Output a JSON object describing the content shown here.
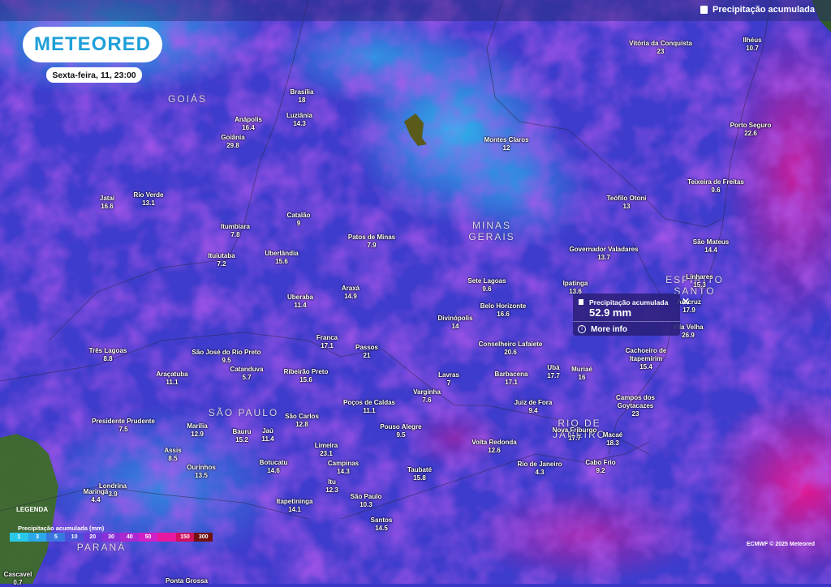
{
  "header": {
    "layer_title": "Precipitação acumulada",
    "layer_icon": "document-icon"
  },
  "brand": {
    "logo_text": "METEORED",
    "date": "Sexta-feira, 11, 23:00"
  },
  "regions": [
    {
      "name": "GOIÁS"
    },
    {
      "name": "MINAS\nGERAIS"
    },
    {
      "name": "SÃO PAULO"
    },
    {
      "name": "RIO DE\nJANEIRO"
    },
    {
      "name": "ESPÍRITO\nSANTO"
    },
    {
      "name": "PARANÁ"
    }
  ],
  "cities": [
    {
      "name": "Vitória da Conquista",
      "value": "23"
    },
    {
      "name": "Ilhéus",
      "value": "10.7"
    },
    {
      "name": "Brasília",
      "value": "18"
    },
    {
      "name": "Luziânia",
      "value": "14.3"
    },
    {
      "name": "Anápolis",
      "value": "16.4"
    },
    {
      "name": "Goiânia",
      "value": "29.8"
    },
    {
      "name": "Montes Claros",
      "value": "12"
    },
    {
      "name": "Porto Seguro",
      "value": "22.6"
    },
    {
      "name": "Teixeira de Freitas",
      "value": "9.6"
    },
    {
      "name": "Jataí",
      "value": "16.6"
    },
    {
      "name": "Rio Verde",
      "value": "13.1"
    },
    {
      "name": "Teófilo Otoni",
      "value": "13"
    },
    {
      "name": "Catalão",
      "value": "9"
    },
    {
      "name": "Itumbiara",
      "value": "7.8"
    },
    {
      "name": "Patos de Minas",
      "value": "7.9"
    },
    {
      "name": "Ituiutaba",
      "value": "7.2"
    },
    {
      "name": "Uberlândia",
      "value": "15.6"
    },
    {
      "name": "São Mateus",
      "value": "14.4"
    },
    {
      "name": "Governador Valadares",
      "value": "13.7"
    },
    {
      "name": "Linhares",
      "value": "15.3"
    },
    {
      "name": "Sete Lagoas",
      "value": "9.6"
    },
    {
      "name": "Ipatinga",
      "value": "13.6"
    },
    {
      "name": "Araxá",
      "value": "14.9"
    },
    {
      "name": "Uberaba",
      "value": "11.4"
    },
    {
      "name": "Belo Horizonte",
      "value": "16.6"
    },
    {
      "name": "Aracruz",
      "value": "17.9"
    },
    {
      "name": "Divinópolis",
      "value": "14"
    },
    {
      "name": "Vila Velha",
      "value": "26.9"
    },
    {
      "name": "Franca",
      "value": "17.1"
    },
    {
      "name": "Passos",
      "value": "21"
    },
    {
      "name": "Conselheiro Lafaiete",
      "value": "20.6"
    },
    {
      "name": "Três Lagoas",
      "value": "8.8"
    },
    {
      "name": "São José do Rio Preto",
      "value": "9.5"
    },
    {
      "name": "Cachoeiro de\nItapemirim",
      "value": "15.4"
    },
    {
      "name": "Araçatuba",
      "value": "11.1"
    },
    {
      "name": "Catanduva",
      "value": "5.7"
    },
    {
      "name": "Ribeirão Preto",
      "value": "15.6"
    },
    {
      "name": "Lavras",
      "value": "7"
    },
    {
      "name": "Barbacena",
      "value": "17.1"
    },
    {
      "name": "Ubá",
      "value": "17.7"
    },
    {
      "name": "Muriaé",
      "value": "16"
    },
    {
      "name": "Varginha",
      "value": "7.6"
    },
    {
      "name": "Campos dos\nGoytacazes",
      "value": "23"
    },
    {
      "name": "Poços de Caldas",
      "value": "11.1"
    },
    {
      "name": "Juiz de Fora",
      "value": "9.4"
    },
    {
      "name": "Presidente Prudente",
      "value": "7.5"
    },
    {
      "name": "São Carlos",
      "value": "12.8"
    },
    {
      "name": "Marília",
      "value": "12.9"
    },
    {
      "name": "Bauru",
      "value": "15.2"
    },
    {
      "name": "Jaú",
      "value": "11.4"
    },
    {
      "name": "Pouso Alegre",
      "value": "9.5"
    },
    {
      "name": "Nova Friburgo",
      "value": "17.7"
    },
    {
      "name": "Macaé",
      "value": "18.3"
    },
    {
      "name": "Limeira",
      "value": "23.1"
    },
    {
      "name": "Volta Redonda",
      "value": "12.6"
    },
    {
      "name": "Assis",
      "value": "8.5"
    },
    {
      "name": "Campinas",
      "value": "14.3"
    },
    {
      "name": "Botucatu",
      "value": "14.6"
    },
    {
      "name": "Ourinhos",
      "value": "13.5"
    },
    {
      "name": "Rio de Janeiro",
      "value": "4.3"
    },
    {
      "name": "Cabo Frio",
      "value": "9.2"
    },
    {
      "name": "Taubaté",
      "value": "15.8"
    },
    {
      "name": "Londrina",
      "value": "3.9"
    },
    {
      "name": "Maringá",
      "value": "4.4"
    },
    {
      "name": "Itu",
      "value": "12.3"
    },
    {
      "name": "Itapetininga",
      "value": "14.1"
    },
    {
      "name": "São Paulo",
      "value": "10.3"
    },
    {
      "name": "Santos",
      "value": "14.5"
    },
    {
      "name": "Cascavel",
      "value": "0.7"
    },
    {
      "name": "Ponta Grossa",
      "value": ""
    }
  ],
  "popup": {
    "title": "Precipitação acumulada",
    "value": "52.9 mm",
    "more_info": "More info"
  },
  "legend": {
    "title": "LEGENDA",
    "subtitle": "Precipitação acumulada (mm)",
    "stops": [
      {
        "label": "1",
        "color": "#29c8e8"
      },
      {
        "label": "3",
        "color": "#2aa8e8"
      },
      {
        "label": "5",
        "color": "#3a78e0"
      },
      {
        "label": "10",
        "color": "#4a50d8"
      },
      {
        "label": "20",
        "color": "#6a3ad8"
      },
      {
        "label": "30",
        "color": "#8a30d8"
      },
      {
        "label": "40",
        "color": "#aa28d0"
      },
      {
        "label": "50",
        "color": "#d020c8"
      },
      {
        "label": "",
        "color": "#e818a0"
      },
      {
        "label": "150",
        "color": "#d01060"
      },
      {
        "label": "300",
        "color": "#701010"
      }
    ]
  },
  "credit": "ECMWF © 2025 Meteored"
}
